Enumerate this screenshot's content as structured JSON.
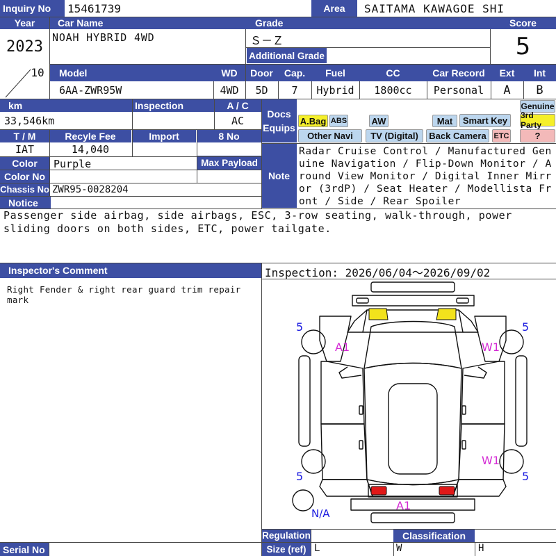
{
  "labels": {
    "inquiry_no": "Inquiry No",
    "area": "Area",
    "year": "Year",
    "car_name": "Car Name",
    "grade": "Grade",
    "score": "Score",
    "additional_grade": "Additional Grade",
    "model": "Model",
    "wd": "WD",
    "door": "Door",
    "cap": "Cap.",
    "fuel": "Fuel",
    "cc": "CC",
    "car_record": "Car Record",
    "ext": "Ext",
    "int": "Int",
    "km": "km",
    "inspection": "Inspection",
    "ac": "A / C",
    "docs": "Docs",
    "equips": "Equips",
    "tm": "T / M",
    "recycle_fee": "Recyle Fee",
    "import": "Import",
    "no8": "8 No",
    "color": "Color",
    "max_payload": "Max Payload",
    "color_no": "Color No",
    "note": "Note",
    "chassis_no": "Chassis No",
    "notice": "Notice",
    "inspector_comment": "Inspector's Comment",
    "regulation": "Regulation",
    "classification": "Classification",
    "size_ref": "Size (ref)",
    "serial_no": "Serial No",
    "size_l": "L",
    "size_w": "W",
    "size_h": "H"
  },
  "values": {
    "inquiry_no": "15461739",
    "area": "SAITAMA KAWAGOE SHI",
    "year": "2023",
    "month": "10",
    "car_name": "NOAH HYBRID 4WD",
    "grade": "Ｓ－Ｚ",
    "score": "5",
    "model": "6AA-ZWR95W",
    "wd": "4WD",
    "door": "5D",
    "cap": "7",
    "fuel": "Hybrid",
    "cc": "1800cc",
    "car_record": "Personal",
    "ext": "A",
    "int": "B",
    "km": "33,546km",
    "ac": "AC",
    "tm": "IAT",
    "recycle_fee": "14,040",
    "color": "Purple",
    "chassis_no": "ZWR95-0028204",
    "note": "Radar Cruise Control / Manufactured Genuine Navigation / Flip-Down Monitor / Around View Monitor / Digital Inner Mirror (3rdP) / Seat Heater / Modellista Front / Side / Rear Spoiler",
    "notice": "Passenger side airbag, side airbags, ESC, 3-row seating, walk-through, power sliding doors on both sides, ETC, power tailgate.",
    "inspector_comment": "Right Fender & right rear guard trim repair mark",
    "inspection_period": "Inspection: 2026/06/04～2026/09/02"
  },
  "equips": {
    "abag": "A.Bag",
    "abs": "ABS",
    "aw": "AW",
    "mat": "Mat",
    "smart_key": "Smart Key",
    "genuine": "Genuine",
    "third_party": "3rd Party",
    "other_navi": "Other Navi",
    "tv_digital": "TV (Digital)",
    "back_camera": "Back Camera",
    "etc": "ETC",
    "question": "?"
  },
  "diagram": {
    "marks": {
      "fl_tire": "5",
      "fr_tire": "5",
      "rl_tire": "5",
      "rr_tire": "5",
      "left_front_fender": "A1",
      "right_front_fender": "W1",
      "right_rear_guard": "W1",
      "rear_bumper": "A1",
      "spare": "N/A"
    },
    "colors": {
      "frame": "#3d4fa3",
      "mark_blue": "#1a1ae0",
      "mark_magenta": "#d42ad4",
      "headlight": "#f2e21c",
      "taillight": "#e01818"
    }
  }
}
